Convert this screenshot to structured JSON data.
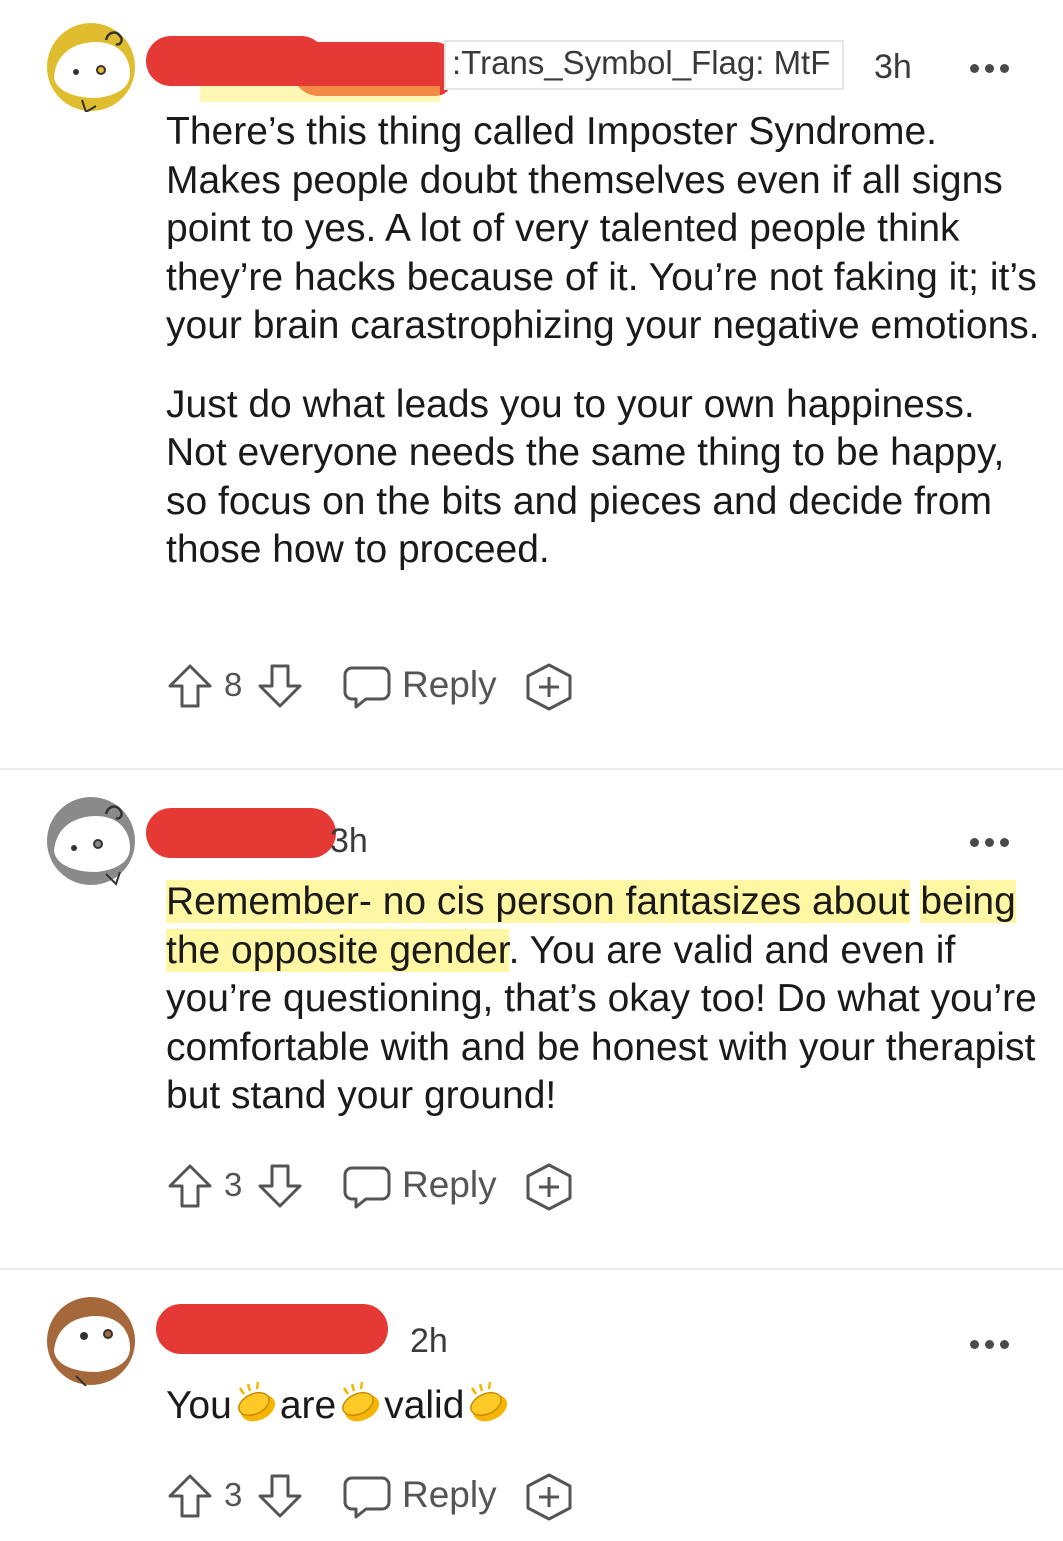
{
  "comments": [
    {
      "flair": ":Trans_Symbol_Flag: MtF",
      "time": "3h",
      "paragraphs": [
        "There’s this thing called Imposter Syndrome. Makes people doubt themselves even if all signs point to yes. A lot of very talented people think they’re hacks because of it. You’re not faking it; it’s your brain carastrophizing your negative emotions.",
        "Just do what leads you to your own happiness. Not everyone needs the same thing to be happy, so focus on the bits and pieces and decide from those how to proceed."
      ],
      "votes": "8",
      "reply_label": "Reply",
      "avatar_color": "#e0bd2e"
    },
    {
      "time": "3h",
      "text_highlighted_a": "Remember- no cis person fantasizes about",
      "text_highlighted_b": "being the opposite gender",
      "text_rest": ". You are valid and even if you’re questioning, that’s okay too! Do what you’re comfortable with and be honest with your therapist but stand your ground!",
      "votes": "3",
      "reply_label": "Reply",
      "avatar_color": "#8a8a8a"
    },
    {
      "time": "2h",
      "words": [
        "You",
        "are",
        "valid"
      ],
      "emoji": "clapping-hands",
      "votes": "3",
      "reply_label": "Reply",
      "avatar_color": "#a5683a"
    }
  ],
  "colors": {
    "redaction": "#e53935",
    "highlight": "#fff05a",
    "icon": "#555555"
  }
}
